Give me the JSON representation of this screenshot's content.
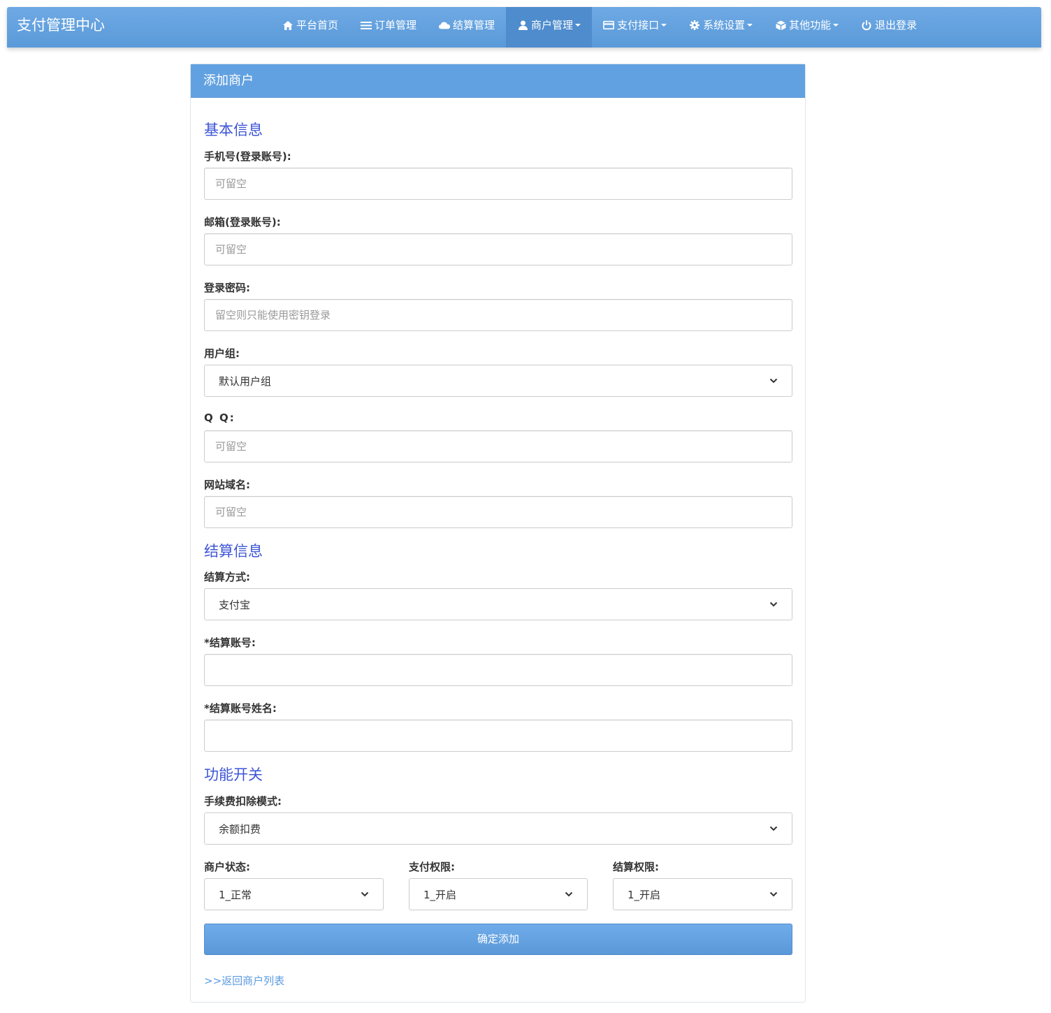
{
  "navbar": {
    "brand": "支付管理中心",
    "items": [
      {
        "label": "平台首页",
        "icon": "home-icon",
        "caret": false
      },
      {
        "label": "订单管理",
        "icon": "list-icon",
        "caret": false
      },
      {
        "label": "结算管理",
        "icon": "cloud-icon",
        "caret": false
      },
      {
        "label": "商户管理",
        "icon": "user-icon",
        "caret": true,
        "active": true
      },
      {
        "label": "支付接口",
        "icon": "card-icon",
        "caret": true
      },
      {
        "label": "系统设置",
        "icon": "gear-icon",
        "caret": true
      },
      {
        "label": "其他功能",
        "icon": "box-icon",
        "caret": true
      },
      {
        "label": "退出登录",
        "icon": "power-icon",
        "caret": false
      }
    ]
  },
  "panel": {
    "title": "添加商户",
    "sections": {
      "basic": "基本信息",
      "settlement": "结算信息",
      "features": "功能开关"
    },
    "fields": {
      "phone": {
        "label": "手机号(登录账号):",
        "placeholder": "可留空",
        "value": ""
      },
      "email": {
        "label": "邮箱(登录账号):",
        "placeholder": "可留空",
        "value": ""
      },
      "password": {
        "label": "登录密码:",
        "placeholder": "留空则只能使用密钥登录",
        "value": ""
      },
      "group": {
        "label": "用户组:",
        "selected": "默认用户组"
      },
      "qq": {
        "label": "Q Q:",
        "placeholder": "可留空",
        "value": ""
      },
      "domain": {
        "label": "网站域名:",
        "placeholder": "可留空",
        "value": ""
      },
      "settle_method": {
        "label": "结算方式:",
        "selected": "支付宝"
      },
      "settle_account": {
        "label": "*结算账号:",
        "value": ""
      },
      "settle_name": {
        "label": "*结算账号姓名:",
        "value": ""
      },
      "fee_mode": {
        "label": "手续费扣除模式:",
        "selected": "余额扣费"
      },
      "merchant_status": {
        "label": "商户状态:",
        "selected": "1_正常"
      },
      "pay_permission": {
        "label": "支付权限:",
        "selected": "1_开启"
      },
      "settle_permission": {
        "label": "结算权限:",
        "selected": "1_开启"
      }
    },
    "submit_label": "确定添加",
    "back_link": ">>返回商户列表"
  },
  "colors": {
    "navbar": "#5a9ad9",
    "nav_active": "#4e8ccd",
    "panel_heading": "#62a1e1",
    "section_title": "#3d55d6",
    "link": "#5b9be0"
  }
}
